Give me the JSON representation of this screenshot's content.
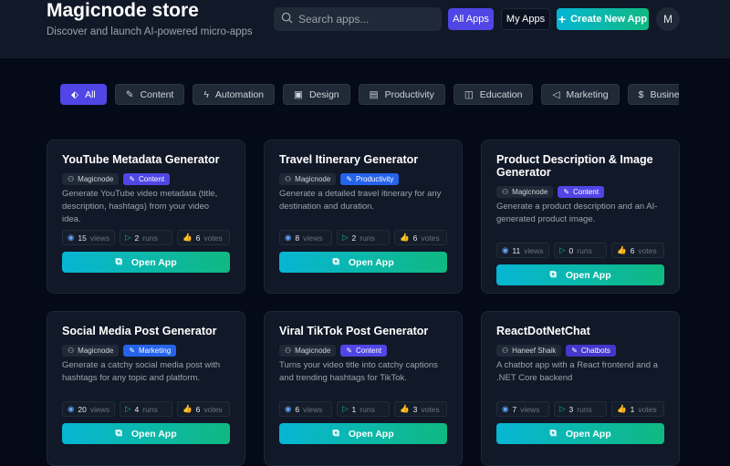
{
  "header": {
    "title": "Magicnode store",
    "subtitle": "Discover and launch AI-powered micro-apps",
    "search_placeholder": "Search apps...",
    "all_apps": "All Apps",
    "my_apps": "My Apps",
    "create": "Create New App",
    "avatar": "M"
  },
  "categories": [
    {
      "label": "All",
      "icon": "tag"
    },
    {
      "label": "Content",
      "icon": "pen"
    },
    {
      "label": "Automation",
      "icon": "bolt"
    },
    {
      "label": "Design",
      "icon": "image"
    },
    {
      "label": "Productivity",
      "icon": "briefcase"
    },
    {
      "label": "Education",
      "icon": "book"
    },
    {
      "label": "Marketing",
      "icon": "megaphone"
    },
    {
      "label": "Business",
      "icon": "dollar"
    }
  ],
  "open_label": "Open App",
  "cards": [
    {
      "title": "YouTube Metadata Generator",
      "author": "Magicnode",
      "category": "Content",
      "cat_color": "#4f46e5",
      "desc": "Generate YouTube video metadata (title, description, hashtags) from your video idea.",
      "views": "15",
      "runs": "2",
      "votes": "6"
    },
    {
      "title": "Travel Itinerary Generator",
      "author": "Magicnode",
      "category": "Productivity",
      "cat_color": "#2563eb",
      "desc": "Generate a detailed travel itinerary for any destination and duration.",
      "views": "8",
      "runs": "2",
      "votes": "6"
    },
    {
      "title": "Product Description & Image Generator",
      "author": "Magicnode",
      "category": "Content",
      "cat_color": "#4f46e5",
      "desc": "Generate a product description and an AI-generated product image.",
      "views": "11",
      "runs": "0",
      "votes": "6"
    },
    {
      "title": "Social Media Post Generator",
      "author": "Magicnode",
      "category": "Marketing",
      "cat_color": "#2563eb",
      "desc": "Generate a catchy social media post with hashtags for any topic and platform.",
      "views": "20",
      "runs": "4",
      "votes": "6"
    },
    {
      "title": "Viral TikTok Post Generator",
      "author": "Magicnode",
      "category": "Content",
      "cat_color": "#4f46e5",
      "desc": "Turns your video title into catchy captions and trending hashtags for TikTok.",
      "views": "6",
      "runs": "1",
      "votes": "3"
    },
    {
      "title": "ReactDotNetChat",
      "author": "Haneef Shaik",
      "category": "Chatbots",
      "cat_color": "#4338ca",
      "desc": "A chatbot app with a React frontend and a .NET Core backend",
      "views": "7",
      "runs": "3",
      "votes": "1"
    }
  ],
  "labels": {
    "views": "views",
    "runs": "runs",
    "votes": "votes"
  }
}
